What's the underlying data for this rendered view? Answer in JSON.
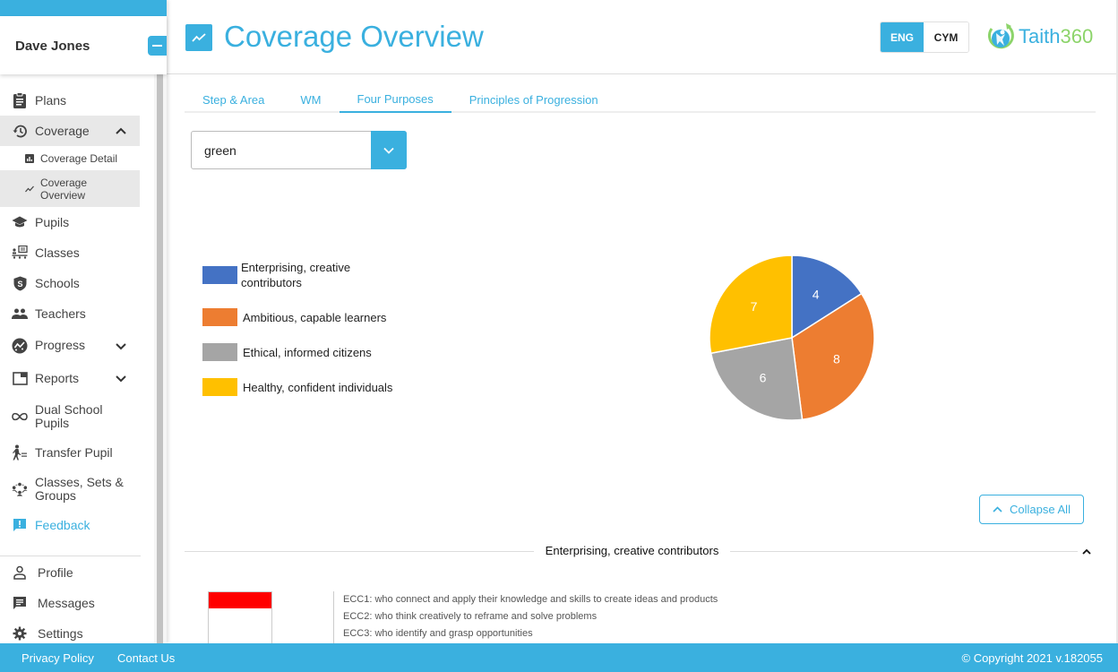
{
  "user": {
    "name": "Dave Jones"
  },
  "sidebar": {
    "items": [
      {
        "label": "Plans",
        "icon": "clipboard-icon"
      },
      {
        "label": "Coverage",
        "icon": "history-icon",
        "expanded": true,
        "children": [
          {
            "label": "Coverage Detail",
            "icon": "bar-chart-icon"
          },
          {
            "label": "Coverage Overview",
            "icon": "trend-icon",
            "active": true
          }
        ]
      },
      {
        "label": "Pupils",
        "icon": "graduation-cap-icon"
      },
      {
        "label": "Classes",
        "icon": "classroom-icon"
      },
      {
        "label": "Schools",
        "icon": "shield-icon"
      },
      {
        "label": "Teachers",
        "icon": "people-icon"
      },
      {
        "label": "Progress",
        "icon": "progress-icon",
        "expandable": true
      },
      {
        "label": "Reports",
        "icon": "reports-icon",
        "expandable": true
      },
      {
        "label": "Dual School Pupils",
        "icon": "infinity-icon"
      },
      {
        "label": "Transfer Pupil",
        "icon": "transfer-icon"
      },
      {
        "label": "Classes, Sets & Groups",
        "icon": "groups-icon"
      },
      {
        "label": "Feedback",
        "icon": "feedback-icon"
      }
    ],
    "bottom": [
      {
        "label": "Profile",
        "icon": "person-icon"
      },
      {
        "label": "Messages",
        "icon": "message-icon"
      },
      {
        "label": "Settings",
        "icon": "gear-icon"
      }
    ]
  },
  "header": {
    "title": "Coverage Overview",
    "lang": {
      "active": "ENG",
      "other": "CYM"
    },
    "logo": {
      "part1": "Taith",
      "part2": "360"
    }
  },
  "tabs": [
    {
      "label": "Step & Area"
    },
    {
      "label": "WM"
    },
    {
      "label": "Four Purposes",
      "active": true
    },
    {
      "label": "Principles of Progression"
    }
  ],
  "filter": {
    "selected": "green"
  },
  "chart_data": {
    "type": "pie",
    "title": "",
    "legend_position": "left",
    "slices": [
      {
        "label": "Enterprising, creative contributors",
        "value": 4,
        "color": "#4472c4"
      },
      {
        "label": "Ambitious, capable learners",
        "value": 8,
        "color": "#ed7d31"
      },
      {
        "label": "Ethical, informed citizens",
        "value": 6,
        "color": "#a5a5a5"
      },
      {
        "label": "Healthy, confident individuals",
        "value": 7,
        "color": "#ffc000"
      }
    ]
  },
  "actions": {
    "collapse_all": "Collapse All"
  },
  "section": {
    "title": "Enterprising, creative contributors",
    "indicator_color": "#ff0000",
    "descriptions": [
      "ECC1: who connect and apply their knowledge and skills to create ideas and products",
      "ECC2: who think creatively to reframe and solve problems",
      "ECC3: who identify and grasp opportunities"
    ]
  },
  "footer": {
    "privacy": "Privacy Policy",
    "contact": "Contact Us",
    "copyright": "© Copyright 2021 v.182055"
  },
  "colors": {
    "accent": "#3ab0df",
    "logo_green": "#8cd46a"
  }
}
